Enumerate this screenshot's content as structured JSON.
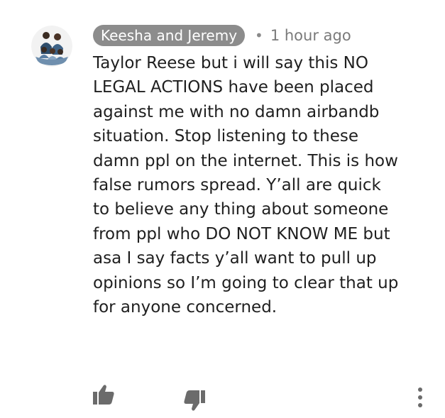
{
  "comment": {
    "author": "Keesha and Jeremy",
    "separator": "•",
    "timestamp": "1 hour ago",
    "text": "Taylor Reese but i will say this NO\nLEGAL ACTIONS have been placed\nagainst me with no damn airbandb\nsituation. Stop listening to these\ndamn ppl on the internet. This is how\nfalse rumors spread. Y’all are quick\nto believe any thing about someone\nfrom ppl who DO NOT KNOW ME but\nasa I say facts y’all want to pull up\nopinions so I’m going to clear that up\nfor anyone concerned."
  },
  "actions": {
    "like_icon": "thumbs-up-icon",
    "dislike_icon": "thumbs-down-icon",
    "more_icon": "more-vertical-icon"
  },
  "colors": {
    "author_chip_bg": "#8c8c8c",
    "text": "#1f1f1f",
    "muted": "#7a7a7a",
    "icon": "#6b6b6b"
  }
}
